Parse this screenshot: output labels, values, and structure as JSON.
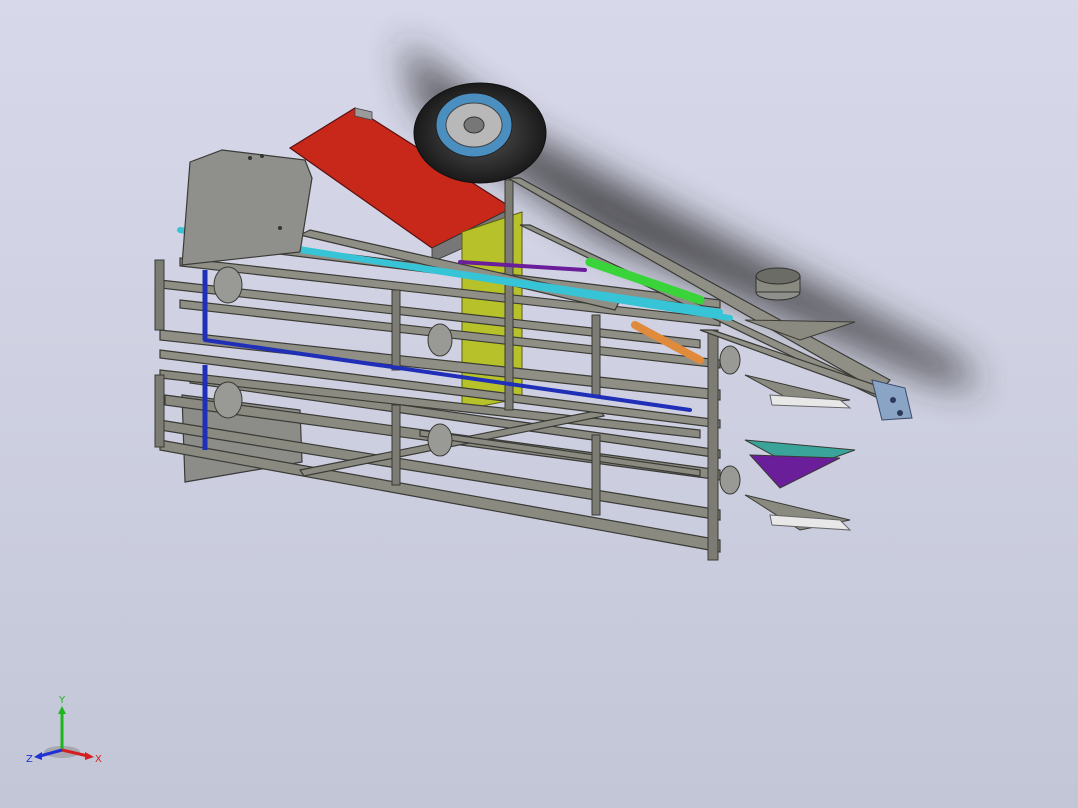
{
  "viewport": {
    "background_top": "#d7d8ea",
    "background_bottom": "#c2c6d6"
  },
  "model": {
    "frame_color": "#8a8a80",
    "hopper_color": "#c8281a",
    "panel_color": "#8f8f8c",
    "upright_color": "#b7c22a",
    "belt_cyan": "#36c4d6",
    "belt_blue": "#1f2fb8",
    "belt_green": "#38d43a",
    "belt_orange": "#e08a3c",
    "belt_purple": "#6a1e9a",
    "plate_teal": "#3aa39a",
    "bracket_blue": "#8aa4c6",
    "tire_color": "#2a2a2a",
    "rim_color": "#4a8fc0"
  },
  "triad": {
    "y_label": "Y",
    "x_label": "X",
    "z_label": "Z",
    "y_color": "#1fb51f",
    "x_color": "#d42020",
    "z_color": "#2030d4"
  }
}
